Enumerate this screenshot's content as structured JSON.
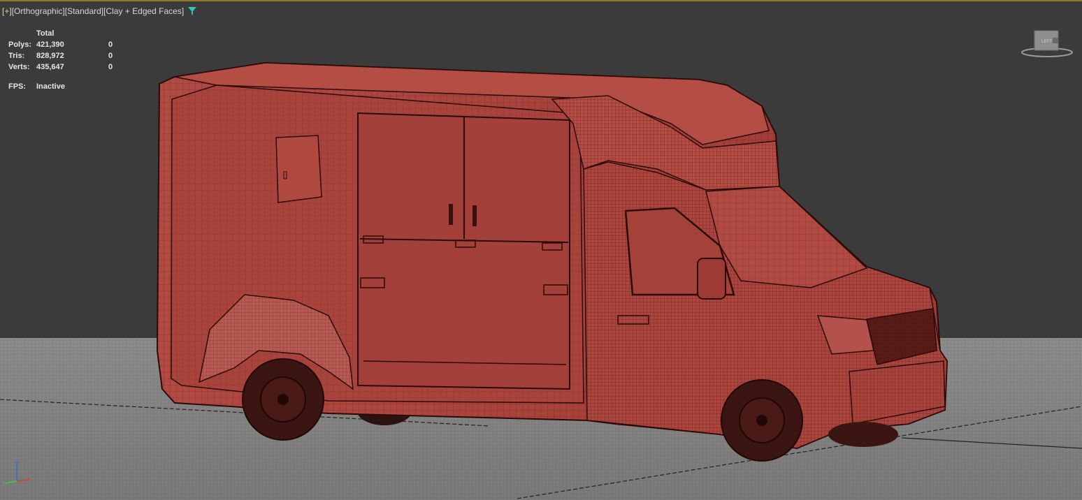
{
  "viewport": {
    "label_parts": [
      "[",
      "+",
      "][",
      "Orthographic",
      "][",
      "Standard",
      "][",
      "Clay + Edged Faces",
      "]"
    ],
    "filter_icon": "funnel-icon",
    "accent_color": "#2ec4c4",
    "border_color": "#8a7a25"
  },
  "stats": {
    "header": "Total",
    "rows": [
      {
        "label": "Polys:",
        "total": "421,390",
        "selected": "0"
      },
      {
        "label": "Tris:",
        "total": "828,972",
        "selected": "0"
      },
      {
        "label": "Verts:",
        "total": "435,647",
        "selected": "0"
      }
    ],
    "fps_label": "FPS:",
    "fps_value": "Inactive"
  },
  "viewcube": {
    "face_label": "LEFT"
  },
  "axis_tripod": {
    "icon": "xyz-axis-icon",
    "x_color": "#e03a3a",
    "y_color": "#3ad13a",
    "z_color": "#3a6ae0"
  },
  "model": {
    "color": "#b5473f",
    "wire_color": "#3a0f0c"
  }
}
